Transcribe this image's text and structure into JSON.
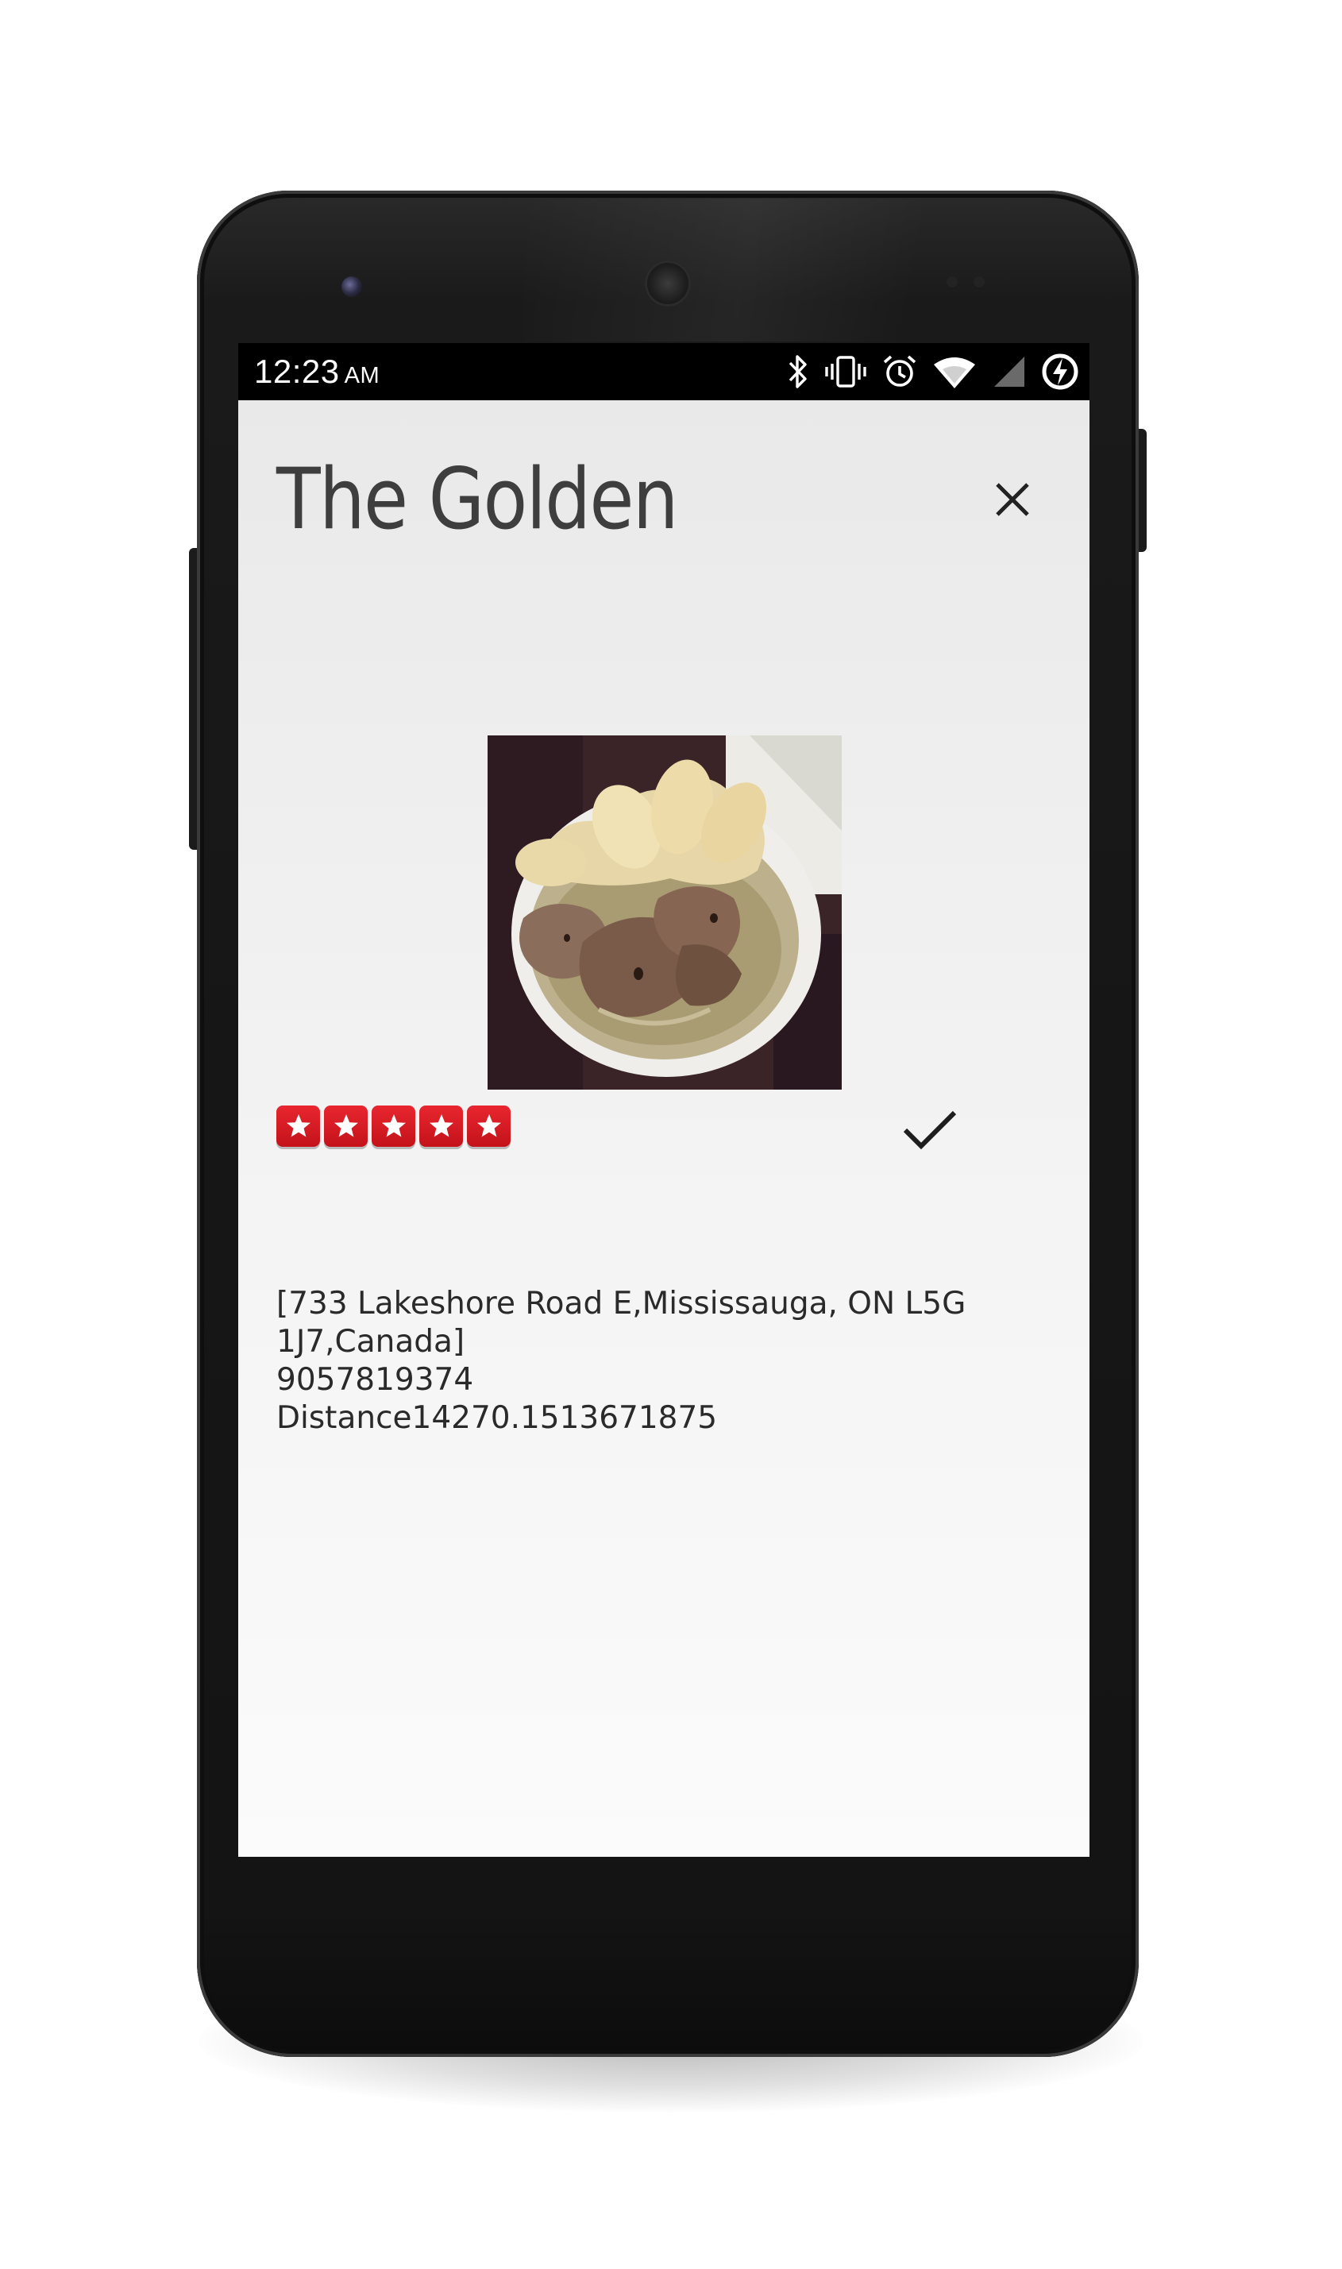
{
  "status_bar": {
    "time": "12:23",
    "ampm": "AM",
    "icons": [
      "bluetooth-icon",
      "vibrate-icon",
      "alarm-icon",
      "wifi-icon",
      "cell-signal-icon",
      "battery-charging-icon"
    ]
  },
  "place": {
    "name": "The Golden",
    "address": "[733 Lakeshore Road E,Mississauga, ON L5G 1J7,Canada]",
    "phone": "9057819374",
    "distance": "Distance14270.1513671875",
    "rating": 5,
    "rating_max": 5
  },
  "actions": {
    "close_icon": "close-icon",
    "confirm_icon": "checkmark-icon"
  },
  "colors": {
    "status_bar": "#000000",
    "title_text": "#3e3e3e",
    "star_red": "#d41c24",
    "body_text": "#2a2a2a"
  }
}
